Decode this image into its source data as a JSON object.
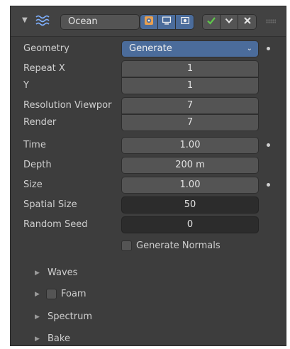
{
  "header": {
    "collapse_icon": "triangle-down-icon",
    "modifier_icon": "ocean-waves-icon",
    "name": "Ocean",
    "display_buttons": [
      {
        "icon": "edit-mode-icon"
      },
      {
        "icon": "viewport-icon"
      },
      {
        "icon": "render-icon"
      }
    ],
    "apply_buttons": [
      {
        "icon": "checkmark-icon"
      },
      {
        "icon": "chevron-down-icon"
      },
      {
        "icon": "close-icon"
      }
    ],
    "grip_icon": "drag-grip-icon"
  },
  "properties": {
    "geometry": {
      "label": "Geometry",
      "value": "Generate"
    },
    "repeat_x": {
      "label": "Repeat X",
      "value": "1"
    },
    "repeat_y": {
      "label": "Y",
      "value": "1"
    },
    "resolution_viewport": {
      "label": "Resolution Viewpor",
      "value": "7"
    },
    "resolution_render": {
      "label": "Render",
      "value": "7"
    },
    "time": {
      "label": "Time",
      "value": "1.00"
    },
    "depth": {
      "label": "Depth",
      "value": "200 m"
    },
    "size": {
      "label": "Size",
      "value": "1.00"
    },
    "spatial_size": {
      "label": "Spatial Size",
      "value": "50"
    },
    "random_seed": {
      "label": "Random Seed",
      "value": "0"
    }
  },
  "generate_normals": {
    "label": "Generate Normals",
    "checked": false
  },
  "subpanels": [
    {
      "label": "Waves",
      "has_checkbox": false
    },
    {
      "label": "Foam",
      "has_checkbox": true
    },
    {
      "label": "Spectrum",
      "has_checkbox": false
    },
    {
      "label": "Bake",
      "has_checkbox": false
    }
  ],
  "colors": {
    "panel_bg": "#3d3d3d",
    "field_bg": "#545454",
    "dark_field_bg": "#2c2c2c",
    "accent": "#4b6c9b",
    "check_green": "#5ec84a"
  }
}
